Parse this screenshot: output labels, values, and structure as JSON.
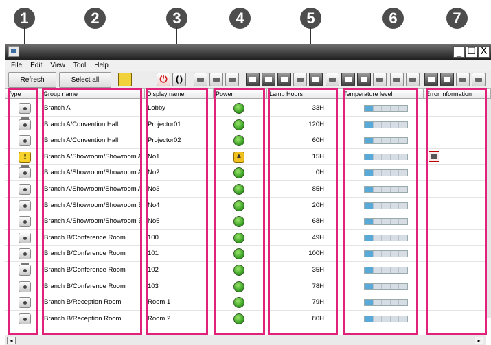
{
  "callouts": [
    "1",
    "2",
    "3",
    "4",
    "5",
    "6",
    "7"
  ],
  "window": {
    "controls": {
      "minimize": "_",
      "maximize": "☐",
      "close": "X"
    }
  },
  "menu": [
    "File",
    "Edit",
    "View",
    "Tool",
    "Help"
  ],
  "toolbar": {
    "refresh_label": "Refresh",
    "select_all_label": "Select all"
  },
  "columns": {
    "type": "Type",
    "group_name": "Group name",
    "display_name": "Display name",
    "power": "Power",
    "lamp_hours": "Lamp Hours",
    "temperature_level": "Temperature level",
    "error_information": "Error information"
  },
  "rows": [
    {
      "type": "single",
      "group": "Branch A",
      "display": "Lobby",
      "power": "on",
      "lamp": "33H",
      "error": ""
    },
    {
      "type": "multi",
      "group": "Branch A/Convention Hall",
      "display": "Projector01",
      "power": "on",
      "lamp": "120H",
      "error": ""
    },
    {
      "type": "single",
      "group": "Branch A/Convention Hall",
      "display": "Projector02",
      "power": "on",
      "lamp": "60H",
      "error": ""
    },
    {
      "type": "warning",
      "group": "Branch A/Showroom/Showroom A",
      "display": "No1",
      "power": "warning",
      "lamp": "15H",
      "error": "error-icon"
    },
    {
      "type": "multi",
      "group": "Branch A/Showroom/Showroom A",
      "display": "No2",
      "power": "on",
      "lamp": "0H",
      "error": ""
    },
    {
      "type": "single",
      "group": "Branch A/Showroom/Showroom A",
      "display": "No3",
      "power": "on",
      "lamp": "85H",
      "error": ""
    },
    {
      "type": "single",
      "group": "Branch A/Showroom/Showroom B",
      "display": "No4",
      "power": "on",
      "lamp": "20H",
      "error": ""
    },
    {
      "type": "single",
      "group": "Branch A/Showroom/Showroom B",
      "display": "No5",
      "power": "on",
      "lamp": "68H",
      "error": ""
    },
    {
      "type": "single",
      "group": "Branch B/Conference Room",
      "display": "100",
      "power": "on",
      "lamp": "49H",
      "error": ""
    },
    {
      "type": "single",
      "group": "Branch B/Conference Room",
      "display": "101",
      "power": "on",
      "lamp": "100H",
      "error": ""
    },
    {
      "type": "multi",
      "group": "Branch B/Conference Room",
      "display": "102",
      "power": "on",
      "lamp": "35H",
      "error": ""
    },
    {
      "type": "single",
      "group": "Branch B/Conference Room",
      "display": "103",
      "power": "on",
      "lamp": "78H",
      "error": ""
    },
    {
      "type": "single",
      "group": "Branch B/Reception Room",
      "display": "Room 1",
      "power": "on",
      "lamp": "79H",
      "error": ""
    },
    {
      "type": "single",
      "group": "Branch B/Reception Room",
      "display": "Room 2",
      "power": "on",
      "lamp": "80H",
      "error": ""
    }
  ],
  "temperature_level_fraction": 0.2,
  "colors": {
    "highlight_frame": "#e0227a",
    "power_on": "#2f9a1e",
    "temperature_fill": "#59a9d9"
  }
}
